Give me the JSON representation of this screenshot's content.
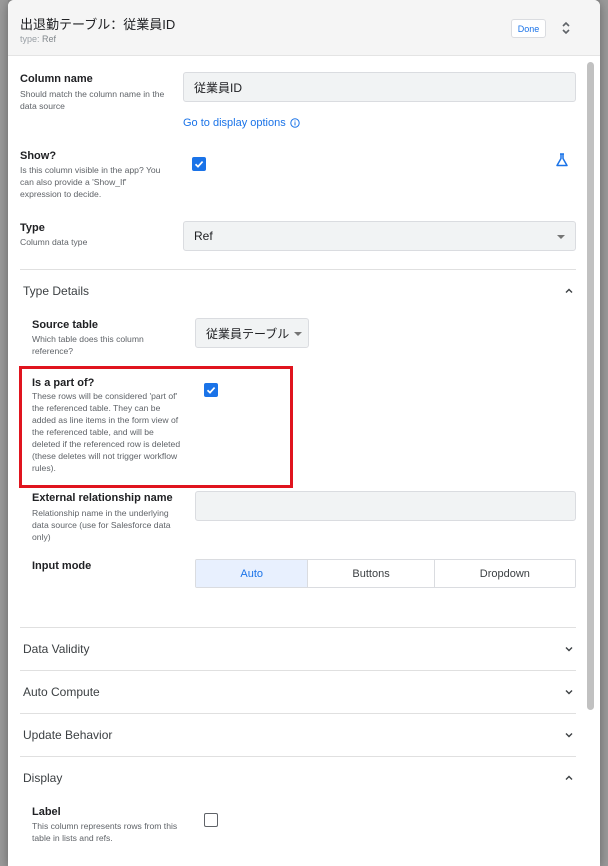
{
  "header": {
    "title": "出退勤テーブル：従業員ID",
    "type_label": "type:",
    "type_value": "Ref",
    "done_label": "Done"
  },
  "column_name": {
    "label": "Column name",
    "desc": "Should match the column name in the data source",
    "value": "従業員ID",
    "link": "Go to display options"
  },
  "show": {
    "label": "Show?",
    "desc": "Is this column visible in the app? You can also provide a 'Show_If' expression to decide.",
    "checked": true
  },
  "type": {
    "label": "Type",
    "desc": "Column data type",
    "value": "Ref"
  },
  "type_details": {
    "title": "Type Details",
    "source_table": {
      "label": "Source table",
      "desc": "Which table does this column reference?",
      "value": "従業員テーブル"
    },
    "is_part_of": {
      "label": "Is a part of?",
      "desc": "These rows will be considered 'part of' the referenced table. They can be added as line items in the form view of the referenced table, and will be deleted if the referenced row is deleted (these deletes will not trigger workflow rules).",
      "checked": true
    },
    "external_relationship": {
      "label": "External relationship name",
      "desc": "Relationship name in the underlying data source (use for Salesforce data only)",
      "value": ""
    },
    "input_mode": {
      "label": "Input mode",
      "options": [
        "Auto",
        "Buttons",
        "Dropdown"
      ],
      "selected": "Auto"
    }
  },
  "sections": {
    "data_validity": "Data Validity",
    "auto_compute": "Auto Compute",
    "update_behavior": "Update Behavior",
    "display": "Display"
  },
  "display_label": {
    "label": "Label",
    "desc": "This column represents rows from this table in lists and refs.",
    "checked": false
  },
  "colors": {
    "accent": "#1a73e8",
    "highlight": "#e0141e"
  }
}
